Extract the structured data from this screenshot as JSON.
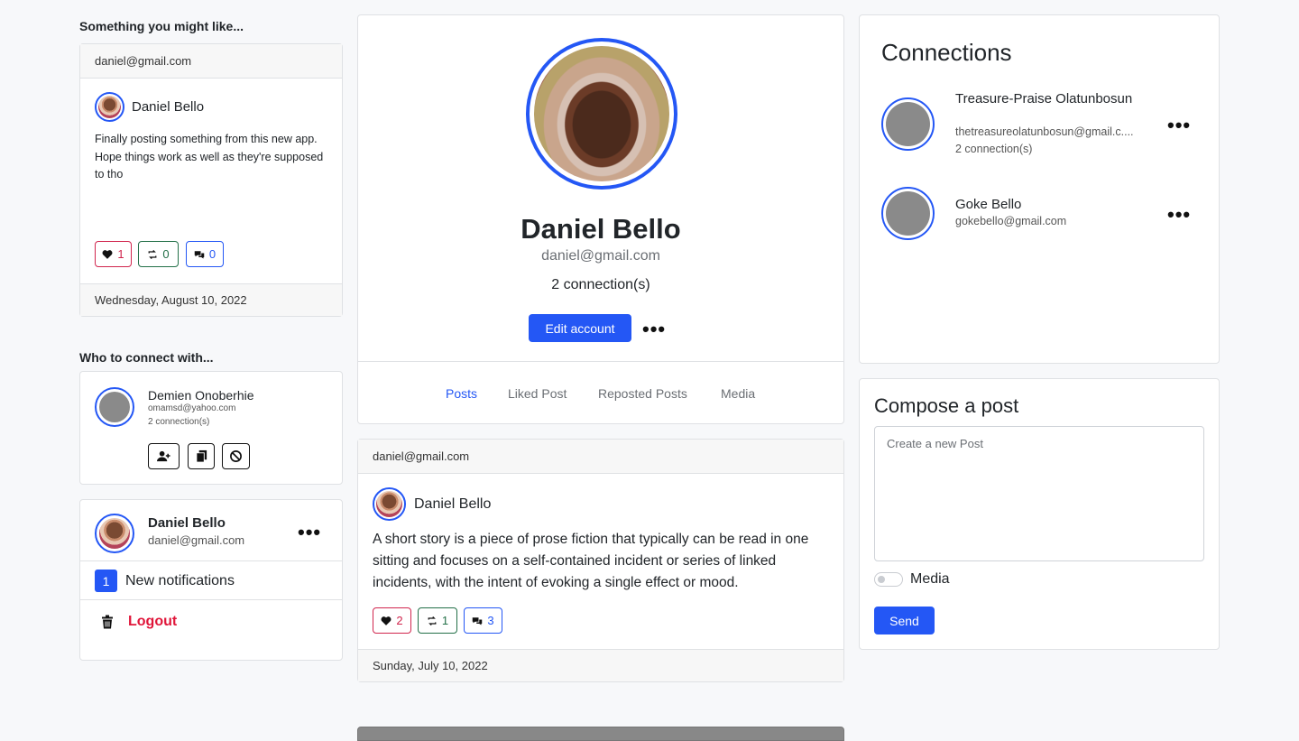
{
  "left": {
    "suggest_title": "Something you might like...",
    "suggest_post": {
      "header_email": "daniel@gmail.com",
      "author": "Daniel Bello",
      "body": "Finally posting something from this new app. Hope things work as well as they're supposed to tho",
      "likes": "1",
      "reposts": "0",
      "comments": "0",
      "date": "Wednesday, August 10, 2022"
    },
    "connect_title": "Who to connect with...",
    "suggest_user": {
      "name": "Demien Onoberhie",
      "email": "omamsd@yahoo.com",
      "connections": "2 connection(s)"
    },
    "account": {
      "name": "Daniel Bello",
      "email": "daniel@gmail.com",
      "notif_count": "1",
      "notif_label": "New notifications",
      "logout_label": "Logout"
    }
  },
  "profile": {
    "name": "Daniel Bello",
    "email": "daniel@gmail.com",
    "connections": "2 connection(s)",
    "edit_label": "Edit account"
  },
  "tabs": [
    {
      "label": "Posts"
    },
    {
      "label": "Liked Post"
    },
    {
      "label": "Reposted Posts"
    },
    {
      "label": "Media"
    }
  ],
  "feed_post": {
    "header_email": "daniel@gmail.com",
    "author": "Daniel Bello",
    "body": "A short story is a piece of prose fiction that typically can be read in one sitting and focuses on a self-contained incident or series of linked incidents, with the intent of evoking a single effect or mood.",
    "likes": "2",
    "reposts": "1",
    "comments": "3",
    "date": "Sunday, July 10, 2022"
  },
  "connections": {
    "title": "Connections",
    "items": [
      {
        "name": "Treasure-Praise Olatunbosun",
        "email": "thetreasureolatunbosun@gmail.c....",
        "count": "2 connection(s)"
      },
      {
        "name": "Goke Bello",
        "email": "gokebello@gmail.com",
        "count": ""
      }
    ]
  },
  "compose": {
    "title": "Compose a post",
    "placeholder": "Create a new Post",
    "media_label": "Media",
    "send_label": "Send"
  },
  "colors": {
    "primary": "#2457f5",
    "like": "#d1254d",
    "repost": "#237048",
    "logout": "#e0163a"
  }
}
